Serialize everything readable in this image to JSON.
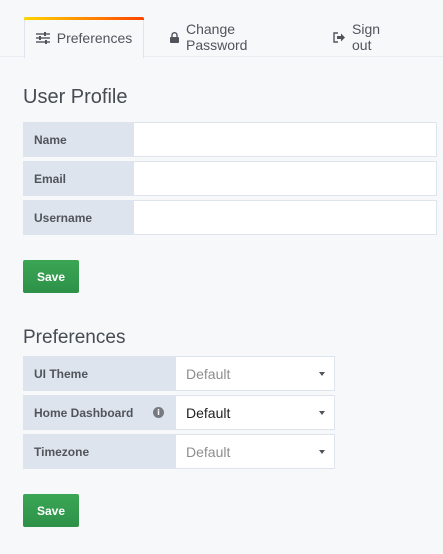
{
  "tabs": {
    "preferences": "Preferences",
    "change_password": "Change Password",
    "sign_out": "Sign out"
  },
  "profile": {
    "title": "User Profile",
    "fields": {
      "name": {
        "label": "Name",
        "value": ""
      },
      "email": {
        "label": "Email",
        "value": ""
      },
      "username": {
        "label": "Username",
        "value": ""
      }
    },
    "save_label": "Save"
  },
  "preferences": {
    "title": "Preferences",
    "ui_theme": {
      "label": "UI Theme",
      "value": "Default"
    },
    "home_dashboard": {
      "label": "Home Dashboard",
      "value": "Default"
    },
    "timezone": {
      "label": "Timezone",
      "value": "Default"
    },
    "save_label": "Save"
  },
  "colors": {
    "accent_gradient_start": "#ffd500",
    "accent_gradient_end": "#ff4400",
    "save_button": "#2d9148",
    "label_background": "#dde4ed",
    "page_background": "#f7f8fa"
  },
  "icons": {
    "preferences_tab": "sliders-icon",
    "change_password_tab": "lock-icon",
    "sign_out_tab": "sign-out-icon",
    "home_dashboard_info": "info-icon",
    "select_caret": "caret-down-icon"
  }
}
